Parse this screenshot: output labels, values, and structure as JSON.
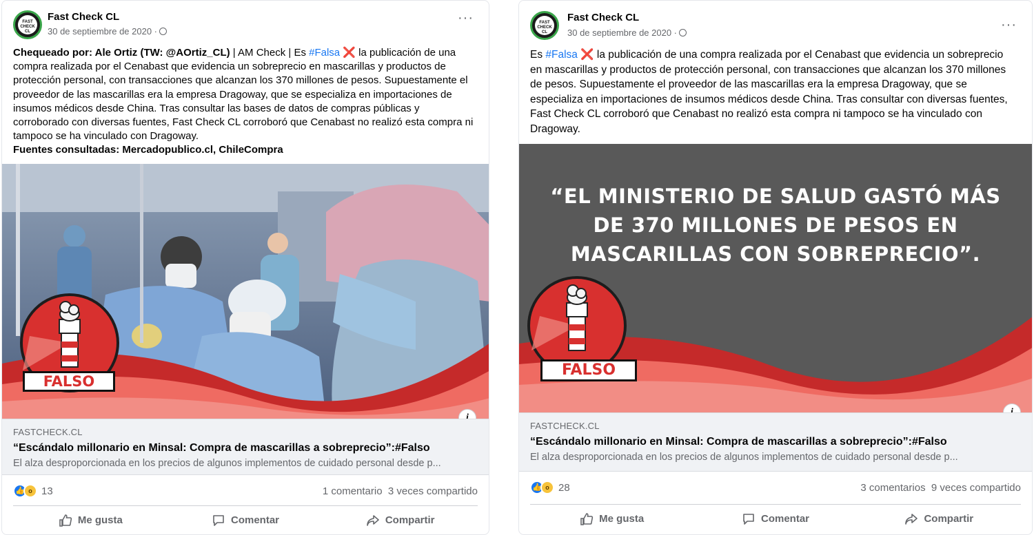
{
  "posts": [
    {
      "page_name": "Fast Check CL",
      "date": "30 de septiembre de 2020 ·",
      "text": {
        "checked_by_label": "Chequeado por: Ale Ortiz (TW: @AOrtiz_CL)",
        "intro": " | AM Check | Es ",
        "hashtag": "#Falsa",
        "x_mark": "❌",
        "body": " la publicación de una compra realizada por el Cenabast que evidencia un sobreprecio en mascarillas y productos de protección personal, con transacciones que alcanzan los 370 millones de pesos. Supuestamente el proveedor de las mascarillas era la empresa Dragoway, que se especializa en importaciones de insumos médicos desde China. Tras consultar las bases de datos de compras públicas y corroborado con diversas fuentes, Fast Check CL corroboró que Cenabast no realizó esta compra ni tampoco se ha vinculado con Dragoway.",
        "sources": "Fuentes consultadas: Mercadopublico.cl, ChileCompra"
      },
      "badge_label": "FALSO",
      "link": {
        "domain": "FASTCHECK.CL",
        "title": "“Escándalo millonario en Minsal: Compra de mascarillas a sobreprecio”:#Falso",
        "description": "El alza desproporcionada en los precios de algunos implementos de cuidado personal desde p..."
      },
      "reactions_count": "13",
      "comments": "1 comentario",
      "shares": "3 veces compartido",
      "actions": {
        "like": "Me gusta",
        "comment": "Comentar",
        "share": "Compartir"
      }
    },
    {
      "page_name": "Fast Check CL",
      "date": "30 de septiembre de 2020 ·",
      "text": {
        "intro": "Es ",
        "hashtag": "#Falsa",
        "x_mark": "❌",
        "body": " la publicación de una compra realizada por el Cenabast que evidencia un sobreprecio en mascarillas y productos de protección personal, con transacciones que alcanzan los 370 millones de pesos. Supuestamente el proveedor de las mascarillas era la empresa Dragoway, que se especializa en importaciones de insumos médicos desde China. Tras consultar con diversas fuentes, Fast Check CL corroboró que Cenabast no realizó esta compra ni tampoco se ha vinculado con Dragoway."
      },
      "quote": "“EL MINISTERIO DE SALUD GASTÓ MÁS DE 370 MILLONES DE PESOS EN MASCARILLAS CON SOBREPRECIO”.",
      "badge_label": "FALSO",
      "link": {
        "domain": "FASTCHECK.CL",
        "title": "“Escándalo millonario en Minsal: Compra de mascarillas a sobreprecio”:#Falso",
        "description": "El alza desproporcionada en los precios de algunos implementos de cuidado personal desde p..."
      },
      "reactions_count": "28",
      "comments": "3 comentarios",
      "shares": "9 veces compartido",
      "actions": {
        "like": "Me gusta",
        "comment": "Comentar",
        "share": "Compartir"
      }
    }
  ],
  "avatar_text": "FAST CHECK CL",
  "colors": {
    "link_blue": "#1877f2",
    "badge_red": "#d8302f",
    "wave_red": "#c52a2a",
    "wave_light": "#ef6b62",
    "quote_bg": "#595959",
    "muted_text": "#65676b"
  }
}
